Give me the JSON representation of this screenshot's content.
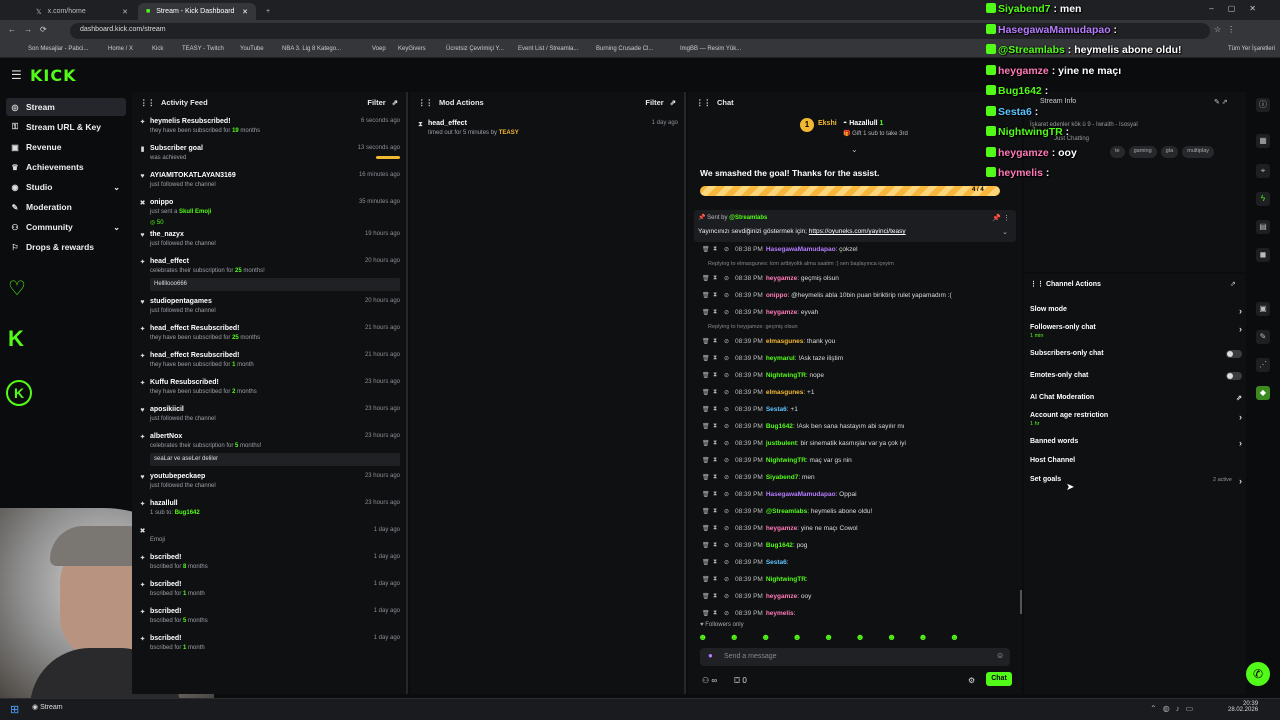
{
  "browser": {
    "tabs": [
      {
        "label": "x.com/home"
      },
      {
        "label": "Stream - Kick Dashboard"
      }
    ],
    "url": "dashboard.kick.com/stream",
    "bookmarks": [
      "Son Mesajlar - Pabci...",
      "Home / X",
      "Kick",
      "TEASY - Twitch",
      "YouTube",
      "NBA 3. Lig 8 Katego...",
      "Voep",
      "KeyGivers",
      "Ücretsiz Çevrimiçi Y...",
      "Event List / Streamla...",
      "Burning Crusade Cl...",
      "ImgBB — Resim Yük...",
      "Tüm Yer İşaretleri"
    ]
  },
  "brand": {
    "logo": "KICK",
    "accent": "#53fc18"
  },
  "sidebar": {
    "items": [
      {
        "label": "Stream",
        "icon": "broadcast-icon"
      },
      {
        "label": "Stream URL & Key",
        "icon": "key-icon"
      },
      {
        "label": "Revenue",
        "icon": "money-icon"
      },
      {
        "label": "Achievements",
        "icon": "trophy-icon"
      },
      {
        "label": "Studio",
        "icon": "studio-icon"
      },
      {
        "label": "Moderation",
        "icon": "wrench-icon"
      },
      {
        "label": "Community",
        "icon": "people-icon"
      },
      {
        "label": "Drops & rewards",
        "icon": "gift-icon"
      }
    ]
  },
  "activity": {
    "title": "Activity Feed",
    "filter": "Filter",
    "items": [
      {
        "name": "heymelis Resubscribed!",
        "pre": "they have been subscribed for ",
        "hl": "19",
        "post": " months",
        "time": "6 seconds ago"
      },
      {
        "name": "Subscriber goal",
        "pre": "was achieved",
        "hl": "",
        "post": "",
        "time": "13 seconds ago"
      },
      {
        "name": "AYIAMITOKATLAYAN3169",
        "pre": "just followed the channel",
        "hl": "",
        "post": "",
        "time": "16 minutes ago"
      },
      {
        "name": "onippo",
        "pre": "just sent a ",
        "hl": "Skull Emoji",
        "post": "",
        "time": "35 minutes ago",
        "extra": "50"
      },
      {
        "name": "the_nazyx",
        "pre": "just followed the channel",
        "hl": "",
        "post": "",
        "time": "19 hours ago"
      },
      {
        "name": "head_effect",
        "pre": "celebrates their subscription for ",
        "hl": "25",
        "post": " months!",
        "time": "20 hours ago",
        "msg": "Hellllooo666"
      },
      {
        "name": "studiopentagames",
        "pre": "just followed the channel",
        "hl": "",
        "post": "",
        "time": "20 hours ago"
      },
      {
        "name": "head_effect Resubscribed!",
        "pre": "they have been subscribed for ",
        "hl": "25",
        "post": " months",
        "time": "21 hours ago"
      },
      {
        "name": "head_effect Resubscribed!",
        "pre": "they have been subscribed for ",
        "hl": "1",
        "post": " month",
        "time": "21 hours ago"
      },
      {
        "name": "Kuffu Resubscribed!",
        "pre": "they have been subscribed for ",
        "hl": "2",
        "post": " months",
        "time": "23 hours ago"
      },
      {
        "name": "aposikiicil",
        "pre": "just followed the channel",
        "hl": "",
        "post": "",
        "time": "23 hours ago"
      },
      {
        "name": "albertNox",
        "pre": "celebrates their subscription for ",
        "hl": "5",
        "post": " months!",
        "time": "23 hours ago",
        "msg": "seaLar ve aseLer deliler"
      },
      {
        "name": "youtubepeckaep",
        "pre": "just followed the channel",
        "hl": "",
        "post": "",
        "time": "23 hours ago"
      },
      {
        "name": "hazallull",
        "pre": "1 sub to: ",
        "hl": "Bug1642",
        "post": "",
        "time": "23 hours ago"
      },
      {
        "name": "",
        "pre": "Emoji",
        "hl": "",
        "post": "",
        "time": "1 day ago"
      },
      {
        "name": "bscribed!",
        "pre": "bscribed for ",
        "hl": "8",
        "post": " months",
        "time": "1 day ago"
      },
      {
        "name": "bscribed!",
        "pre": "bscribed for ",
        "hl": "1",
        "post": " month",
        "time": "1 day ago"
      },
      {
        "name": "bscribed!",
        "pre": "bscribed for ",
        "hl": "5",
        "post": " months",
        "time": "1 day ago"
      },
      {
        "name": "bscribed!",
        "pre": "bscribed for ",
        "hl": "1",
        "post": " month",
        "time": "1 day ago"
      }
    ]
  },
  "mod": {
    "title": "Mod Actions",
    "filter": "Filter",
    "items": [
      {
        "name": "head_effect",
        "pre": "timed out for 5 minutes by ",
        "by": "TEASY",
        "time": "1 day ago"
      }
    ]
  },
  "chat": {
    "title": "Chat",
    "top_user1": "Ekshi",
    "top_user2": "Hazallull",
    "top_count": "1",
    "gift_text": "Gift 1 sub to take 3rd",
    "goal_text": "We smashed the goal! Thanks for the assist.",
    "goal_count": "4 / 4",
    "goal_progress": 1.0,
    "pinned_by_prefix": "Sent by",
    "pinned_by": "@Streamlabs",
    "pinned_text": "Yayıncınızı sevdiğinizi göstermek için; ",
    "pinned_link": "https://oyuneks.com/yayinci/teasy",
    "messages": [
      {
        "time": "08:38 PM",
        "user": "HasegawaMamudapao",
        "color": "p",
        "text": "çokzel"
      },
      {
        "reply": "Replying to elmasgunes: tom artbiyoltk alma saatim :) sen başlayınca içeyim"
      },
      {
        "time": "08:38 PM",
        "user": "heygamze",
        "color": "pk",
        "text": "geçmiş olsun"
      },
      {
        "time": "08:39 PM",
        "user": "onippo",
        "color": "pk",
        "text": "@heymelis abla 10bin puan biriktirip rulet yapamadım :("
      },
      {
        "time": "08:39 PM",
        "user": "heygamze",
        "color": "pk",
        "text": "eyvah"
      },
      {
        "reply": "Replying to heygamze: geçmiş olsun"
      },
      {
        "time": "08:39 PM",
        "user": "elmasgunes",
        "color": "y",
        "text": "thank you"
      },
      {
        "time": "08:39 PM",
        "user": "heymarul",
        "color": "g",
        "text": "!Ask taze iliştim"
      },
      {
        "time": "08:39 PM",
        "user": "NightwingTR",
        "color": "g",
        "text": "nope"
      },
      {
        "time": "08:39 PM",
        "user": "elmasgunes",
        "color": "y",
        "text": "+1"
      },
      {
        "time": "08:39 PM",
        "user": "Sesta6",
        "color": "c",
        "text": "+1"
      },
      {
        "time": "08:39 PM",
        "user": "Bug1642",
        "color": "g",
        "text": "!Ask ben sana hastayım abi sayılır mı"
      },
      {
        "time": "08:39 PM",
        "user": "justbulent",
        "color": "g",
        "text": "bir sinematik kasmışlar var ya çok iyi"
      },
      {
        "time": "08:39 PM",
        "user": "NightwingTR",
        "color": "g",
        "text": "maç var gs nin"
      },
      {
        "time": "08:39 PM",
        "user": "Siyabend7",
        "color": "g",
        "text": "men"
      },
      {
        "time": "08:39 PM",
        "user": "HasegawaMamudapao",
        "color": "p",
        "text": "Oppai"
      },
      {
        "time": "08:39 PM",
        "user": "@Streamlabs",
        "color": "g",
        "text": "heymelis abone oldu!"
      },
      {
        "time": "08:39 PM",
        "user": "heygamze",
        "color": "pk",
        "text": "yine ne maçı Cowol"
      },
      {
        "time": "08:39 PM",
        "user": "Bug1642",
        "color": "g",
        "text": "pog"
      },
      {
        "time": "08:39 PM",
        "user": "Sesta6",
        "color": "c",
        "text": ""
      },
      {
        "time": "08:39 PM",
        "user": "NightwingTR",
        "color": "g",
        "text": ""
      },
      {
        "time": "08:39 PM",
        "user": "heygamze",
        "color": "pk",
        "text": "ooy"
      },
      {
        "time": "08:39 PM",
        "user": "heymelis",
        "color": "pk",
        "text": ""
      }
    ],
    "followers_only": "Followers only",
    "placeholder": "Send a message",
    "points": "0",
    "send": "Chat"
  },
  "overlay": {
    "lines": [
      {
        "user": "Siyabend7",
        "text": " : men",
        "color": "#53fc18"
      },
      {
        "user": "HasegawaMamudapao",
        "text": " :",
        "color": "#b77cff"
      },
      {
        "user": "@Streamlabs",
        "text": " : heymelis abone oldu!",
        "color": "#53fc18"
      },
      {
        "user": "heygamze",
        "text": " : yine ne maçı",
        "color": "#ff7ab8"
      },
      {
        "user": "Bug1642",
        "text": " :",
        "color": "#53fc18"
      },
      {
        "user": "Sesta6",
        "text": " :",
        "color": "#5ec3ff"
      },
      {
        "user": "NightwingTR",
        "text": " :",
        "color": "#53fc18"
      },
      {
        "user": "heygamze",
        "text": " : ooy",
        "color": "#ff7ab8"
      },
      {
        "user": "heymelis",
        "text": " :",
        "color": "#ff7ab8"
      }
    ]
  },
  "stream_info": {
    "title": "Stream Info",
    "line1": "İşkaret edenler kök ü 9 - Iwraith - Isosyal",
    "category": "Just Chatting",
    "tags": [
      "te",
      "gaming",
      "gta",
      "multiplay"
    ]
  },
  "channel_actions": {
    "title": "Channel Actions",
    "items": [
      {
        "label": "Slow mode",
        "sub": "",
        "kind": "arrow"
      },
      {
        "label": "Followers-only chat",
        "sub": "1 min",
        "kind": "arrow"
      },
      {
        "label": "Subscribers-only chat",
        "sub": "",
        "kind": "toggle"
      },
      {
        "label": "Emotes-only chat",
        "sub": "",
        "kind": "toggle"
      },
      {
        "label": "AI Chat Moderation",
        "sub": "",
        "kind": "ext"
      },
      {
        "label": "Account age restriction",
        "sub": "1 hr",
        "kind": "arrow"
      },
      {
        "label": "Banned words",
        "sub": "",
        "kind": "arrow"
      },
      {
        "label": "Host Channel",
        "sub": "",
        "kind": "none"
      },
      {
        "label": "Set goals",
        "sub": "",
        "kind": "arrow",
        "badge": "2 active"
      }
    ]
  },
  "taskbar": {
    "app": "Stream",
    "clock": "20:39",
    "date": "28.02.2026"
  }
}
